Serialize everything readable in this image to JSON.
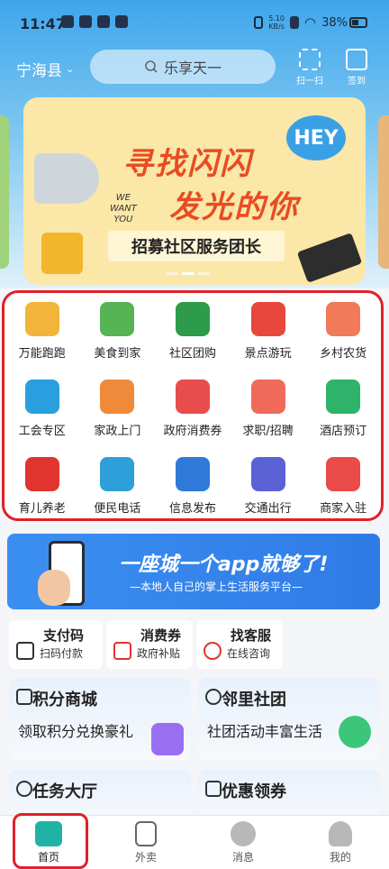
{
  "status": {
    "time": "11:47",
    "net_speed_value": "5.10",
    "net_speed_unit": "KB/s",
    "battery": "38%"
  },
  "header": {
    "location": "宁海县",
    "search_placeholder": "乐享天一",
    "scan_label": "扫一扫",
    "signin_label": "签到"
  },
  "banner": {
    "title_line1": "寻找闪闪",
    "title_line2": "发光的你",
    "badge": "HEY",
    "we_want": "WE",
    "we_want2": "WANT",
    "we_want3": "YOU",
    "subtitle": "招募社区服务团长",
    "slides": 3,
    "active_slide": 2
  },
  "services": [
    {
      "label": "万能跑跑",
      "icon": "delivery-truck-icon",
      "color": "#f2b43a"
    },
    {
      "label": "美食到家",
      "icon": "burger-drink-icon",
      "color": "#56b454"
    },
    {
      "label": "社区团购",
      "icon": "building-icon",
      "color": "#2d9b4a"
    },
    {
      "label": "景点游玩",
      "icon": "map-pin-icon",
      "color": "#e8473e"
    },
    {
      "label": "乡村农货",
      "icon": "package-icon",
      "color": "#f07a5a"
    },
    {
      "label": "工会专区",
      "icon": "door-building-icon",
      "color": "#2a9fe0"
    },
    {
      "label": "家政上门",
      "icon": "house-icon",
      "color": "#f08a3b"
    },
    {
      "label": "政府消费券",
      "icon": "coupon-icon",
      "color": "#e84d4d"
    },
    {
      "label": "求职/招聘",
      "icon": "resume-icon",
      "color": "#ef6a5a"
    },
    {
      "label": "酒店预订",
      "icon": "hotel-icon",
      "color": "#2fb36b"
    },
    {
      "label": "育儿养老",
      "icon": "hearts-icon",
      "color": "#e2342e"
    },
    {
      "label": "便民电话",
      "icon": "phonebook-icon",
      "color": "#2e9fd8"
    },
    {
      "label": "信息发布",
      "icon": "vr-glasses-icon",
      "color": "#2f7ad8"
    },
    {
      "label": "交通出行",
      "icon": "car-icon",
      "color": "#5a62d6"
    },
    {
      "label": "商家入驻",
      "icon": "shop-phone-icon",
      "color": "#e94b48"
    }
  ],
  "promo": {
    "title": "一座城一个app就够了!",
    "subtitle": "—本地人自己的掌上生活服务平台—"
  },
  "quick": [
    {
      "title": "支付码",
      "sub": "扫码付款",
      "icon": "qr-code-icon",
      "color": "#333333"
    },
    {
      "title": "消费券",
      "sub": "政府补贴",
      "icon": "yen-ticket-icon",
      "color": "#e2342e"
    },
    {
      "title": "找客服",
      "sub": "在线咨询",
      "icon": "headset-icon",
      "color": "#e2342e"
    }
  ],
  "cards": [
    {
      "title": "积分商城",
      "sub": "领取积分兑换豪礼",
      "icon": "yen-icon",
      "img": "shopping-bag-icon",
      "img_color": "#9a6ef0"
    },
    {
      "title": "邻里社团",
      "sub": "社团活动丰富生活",
      "icon": "people-icon",
      "img": "chat-bubble-icon",
      "img_color": "#3cc67a"
    },
    {
      "title": "任务大厅",
      "sub": "",
      "icon": "person-yen-icon",
      "img": "",
      "img_color": ""
    },
    {
      "title": "优惠领券",
      "sub": "",
      "icon": "yen-coupon-icon",
      "img": "",
      "img_color": ""
    }
  ],
  "tabs": [
    {
      "label": "首页",
      "icon": "home-icon",
      "active": true
    },
    {
      "label": "外卖",
      "icon": "star-bookmark-icon",
      "active": false
    },
    {
      "label": "消息",
      "icon": "message-icon",
      "active": false
    },
    {
      "label": "我的",
      "icon": "user-icon",
      "active": false
    }
  ],
  "colors": {
    "highlight": "#e0202a",
    "accent": "#21b2a6",
    "sky": "#3fa6ec"
  }
}
